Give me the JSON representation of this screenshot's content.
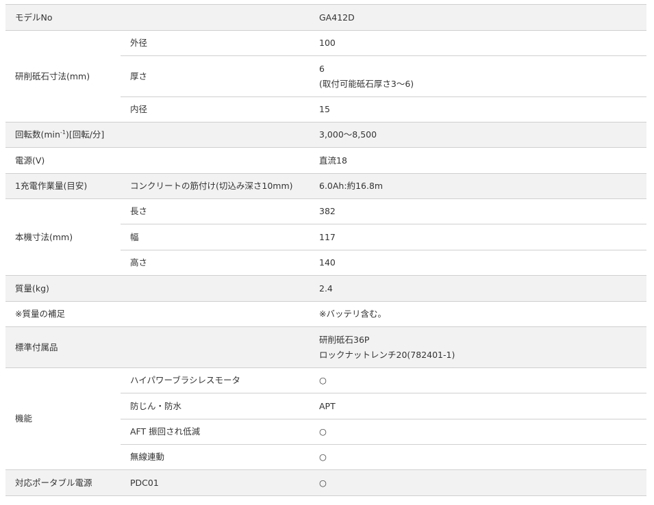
{
  "rows": {
    "model": {
      "label": "モデルNo",
      "value": "GA412D"
    },
    "wheel": {
      "label": "研削砥石寸法(mm)",
      "outer": {
        "sub": "外径",
        "value": "100"
      },
      "thick": {
        "sub": "厚さ",
        "value": "6",
        "note": "(取付可能砥石厚さ3〜6)"
      },
      "inner": {
        "sub": "内径",
        "value": "15"
      }
    },
    "rpm": {
      "label_a": "回転数(min",
      "label_sup": "-1",
      "label_b": ")[回転/分]",
      "value": "3,000〜8,500"
    },
    "power": {
      "label": "電源(V)",
      "value": "直流18"
    },
    "work": {
      "label": "1充電作業量(目安)",
      "sub": "コンクリートの筋付け(切込み深さ10mm)",
      "value": "6.0Ah:約16.8m"
    },
    "size": {
      "label": "本機寸法(mm)",
      "length": {
        "sub": "長さ",
        "value": "382"
      },
      "width": {
        "sub": "幅",
        "value": "117"
      },
      "height": {
        "sub": "高さ",
        "value": "140"
      }
    },
    "mass": {
      "label": "質量(kg)",
      "value": "2.4"
    },
    "mass_note": {
      "label": "※質量の補足",
      "value": "※バッテリ含む。"
    },
    "accessories": {
      "label": "標準付属品",
      "value1": "研削砥石36P",
      "value2": "ロックナットレンチ20(782401-1)"
    },
    "features": {
      "label": "機能",
      "motor": {
        "sub": "ハイパワーブラシレスモータ",
        "value": "○"
      },
      "dust": {
        "sub": "防じん・防水",
        "value": "APT"
      },
      "aft": {
        "sub": "AFT 振回され低減",
        "value": "○"
      },
      "wireless": {
        "sub": "無線連動",
        "value": "○"
      }
    },
    "portable": {
      "label": "対応ポータブル電源",
      "sub": "PDC01",
      "value": "○"
    }
  }
}
